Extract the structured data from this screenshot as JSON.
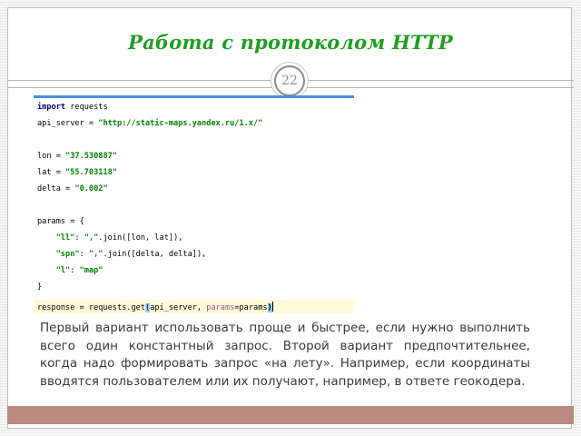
{
  "slide": {
    "title": "Работа с протоколом HTTP",
    "page_number": "22",
    "body_text": "Первый вариант использовать проще и быстрее, если нужно выполнить всего один константный запрос. Второй вариант предпочтительнее, когда надо формировать запрос «на лету». Например, если координаты вводятся пользователем или их получают, например, в ответе геокодера."
  },
  "code": {
    "l1_kw": "import",
    "l1_rest": " requests",
    "l2_id": "api_server = ",
    "l2_str": "\"http://static-maps.yandex.ru/1.x/\"",
    "l4_id": "lon = ",
    "l4_str": "\"37.530887\"",
    "l5_id": "lat = ",
    "l5_str": "\"55.703118\"",
    "l6_id": "delta = ",
    "l6_str": "\"0.002\"",
    "l8": "params = {",
    "l9_key": "\"ll\"",
    "l9_sep": ": ",
    "l9_str": "\",\"",
    "l9_rest": ".join([lon, lat]),",
    "l10_key": "\"spn\"",
    "l10_sep": ": ",
    "l10_str": "\",\"",
    "l10_rest": ".join([delta, delta]),",
    "l11_key": "\"l\"",
    "l11_sep": ": ",
    "l11_str": "\"map\"",
    "l12": "}",
    "l13_a": "response = requests.get",
    "l13_lp": "(",
    "l13_b": "api_server, ",
    "l13_par": "params",
    "l13_c": "=params",
    "l13_rp": ")"
  }
}
